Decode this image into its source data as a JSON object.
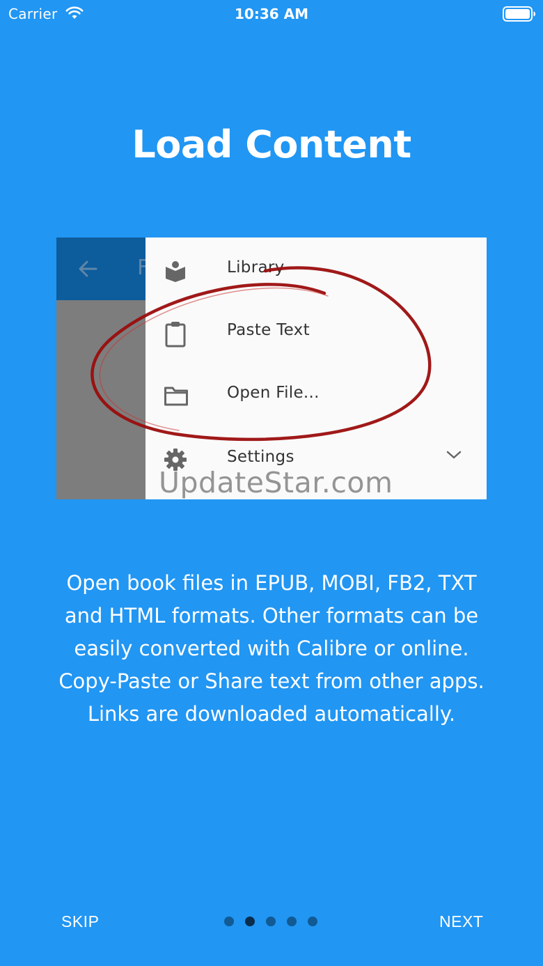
{
  "status_bar": {
    "carrier": "Carrier",
    "time": "10:36 AM"
  },
  "title": "Load Content",
  "preview": {
    "menu_items": [
      {
        "label": "Library",
        "icon": "library-book-icon"
      },
      {
        "label": "Paste Text",
        "icon": "clipboard-icon"
      },
      {
        "label": "Open File...",
        "icon": "folder-icon"
      },
      {
        "label": "Settings",
        "icon": "gear-icon"
      }
    ],
    "appbar_title_peek": "F",
    "watermark": "UpdateStar.com"
  },
  "description": {
    "lines": [
      "Open book files in EPUB, MOBI, FB2, TXT",
      "and HTML formats. Other formats can be",
      "easily converted with Calibre or online.",
      "Copy-Paste or Share text from other apps.",
      "Links are downloaded automatically."
    ]
  },
  "footer": {
    "skip_label": "SKIP",
    "next_label": "NEXT",
    "page_count": 5,
    "current_page": 2
  },
  "colors": {
    "background": "#2196f3",
    "appbar": "#0d5c9c",
    "dot_inactive": "#125a94",
    "dot_active": "#0a2d4b",
    "circle_stroke": "#9b0d0d"
  }
}
